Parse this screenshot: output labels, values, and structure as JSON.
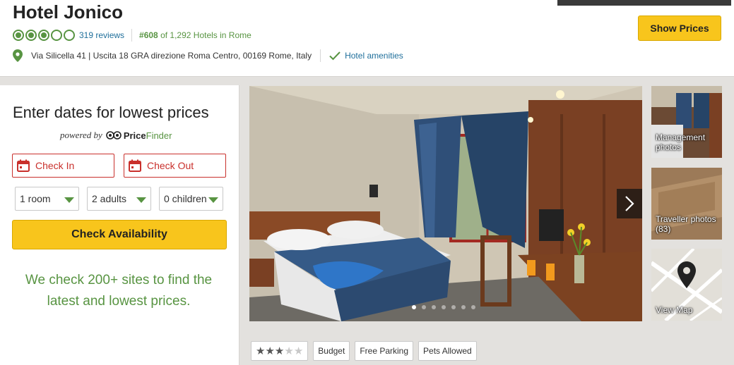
{
  "header": {
    "hotel_name": "Hotel Jonico",
    "rating_bubbles": {
      "filled": 3,
      "total": 5
    },
    "reviews": "319 reviews",
    "rank_number": "#608",
    "rank_text": " of 1,292 Hotels in Rome",
    "address": "Via Silicella 41 | Uscita 18 GRA direzione Roma Centro, 00169 Rome, Italy",
    "amenities_link": "Hotel amenities",
    "show_prices": "Show Prices"
  },
  "price_panel": {
    "title": "Enter dates for lowest prices",
    "powered_by": "powered by",
    "brand_price": "Price",
    "brand_finder": "Finder",
    "check_in": "Check In",
    "check_out": "Check Out",
    "rooms": "1 room",
    "adults": "2 adults",
    "children": "0 children",
    "check_availability": "Check Availability",
    "promo": "We check 200+ sites to find the latest and lowest prices."
  },
  "gallery": {
    "dots": 7,
    "active_dot": 0,
    "thumbnails": [
      {
        "label": "Management photos"
      },
      {
        "label": "Traveller photos (83)"
      },
      {
        "label": "View Map"
      }
    ]
  },
  "tags": {
    "star_rating": {
      "filled": 3,
      "total": 5
    },
    "items": [
      "Budget",
      "Free Parking",
      "Pets Allowed"
    ]
  },
  "colors": {
    "accent_green": "#589442",
    "link_blue": "#1f6f9b",
    "cta_yellow": "#f8c51c",
    "date_red": "#c9302c"
  },
  "icons": [
    "map-pin-icon",
    "checkmark-icon",
    "calendar-icon",
    "owl-icon",
    "chevron-right-icon",
    "map-marker-icon",
    "star-icon"
  ]
}
